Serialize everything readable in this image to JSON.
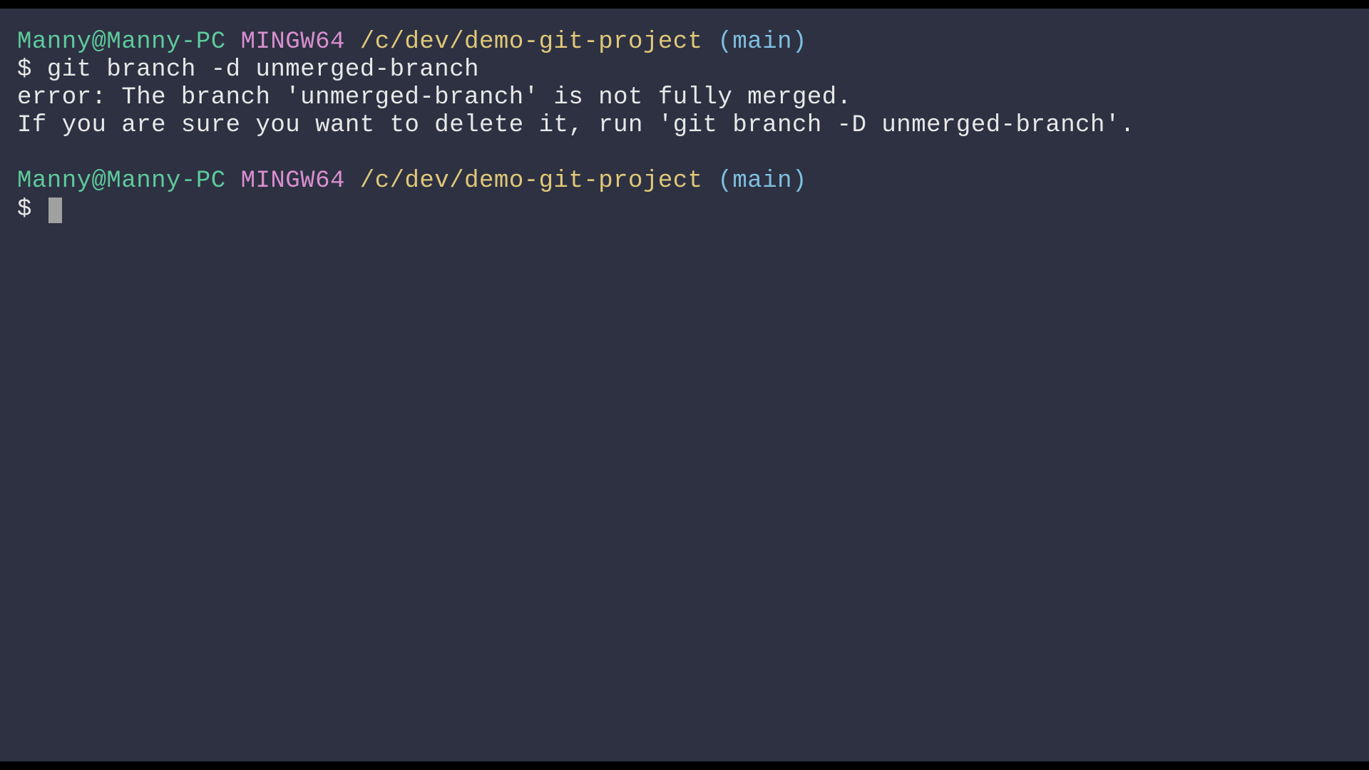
{
  "prompt1": {
    "user_host": "Manny@Manny-PC",
    "mingw": "MINGW64",
    "path": "/c/dev/demo-git-project",
    "branch": "(main)"
  },
  "command1": {
    "dollar": "$",
    "text": "git branch -d unmerged-branch"
  },
  "output1": "error: The branch 'unmerged-branch' is not fully merged.",
  "output2": "If you are sure you want to delete it, run 'git branch -D unmerged-branch'.",
  "prompt2": {
    "user_host": "Manny@Manny-PC",
    "mingw": "MINGW64",
    "path": "/c/dev/demo-git-project",
    "branch": "(main)"
  },
  "command2": {
    "dollar": "$",
    "text": ""
  }
}
